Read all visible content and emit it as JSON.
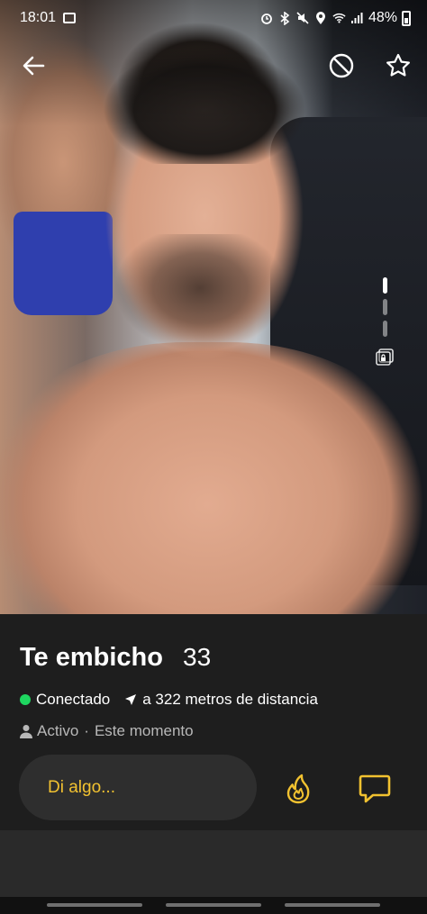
{
  "status_bar": {
    "time": "18:01",
    "battery": "48%",
    "icons": [
      "gallery-icon",
      "alarm-icon",
      "bluetooth-icon",
      "mute-icon",
      "location-icon",
      "wifi-icon",
      "signal-icon",
      "battery-icon"
    ]
  },
  "top_bar": {
    "back_icon": "arrow-left-icon",
    "block_icon": "block-icon",
    "favorite_icon": "star-icon"
  },
  "photo": {
    "pages": 4,
    "active_page": 1,
    "private_album_icon": "private-album-icon"
  },
  "profile": {
    "name": "Te embicho",
    "age": "33",
    "online_status": "Conectado",
    "distance": "a 322 metros de distancia",
    "activity_label": "Activo",
    "activity_time": "Este momento"
  },
  "actions": {
    "message_placeholder": "Di algo...",
    "tap_icon": "flame-icon",
    "chat_icon": "chat-bubble-icon"
  },
  "colors": {
    "accent": "#f2c230",
    "online": "#1ed760",
    "panel": "#1e1e1e"
  }
}
